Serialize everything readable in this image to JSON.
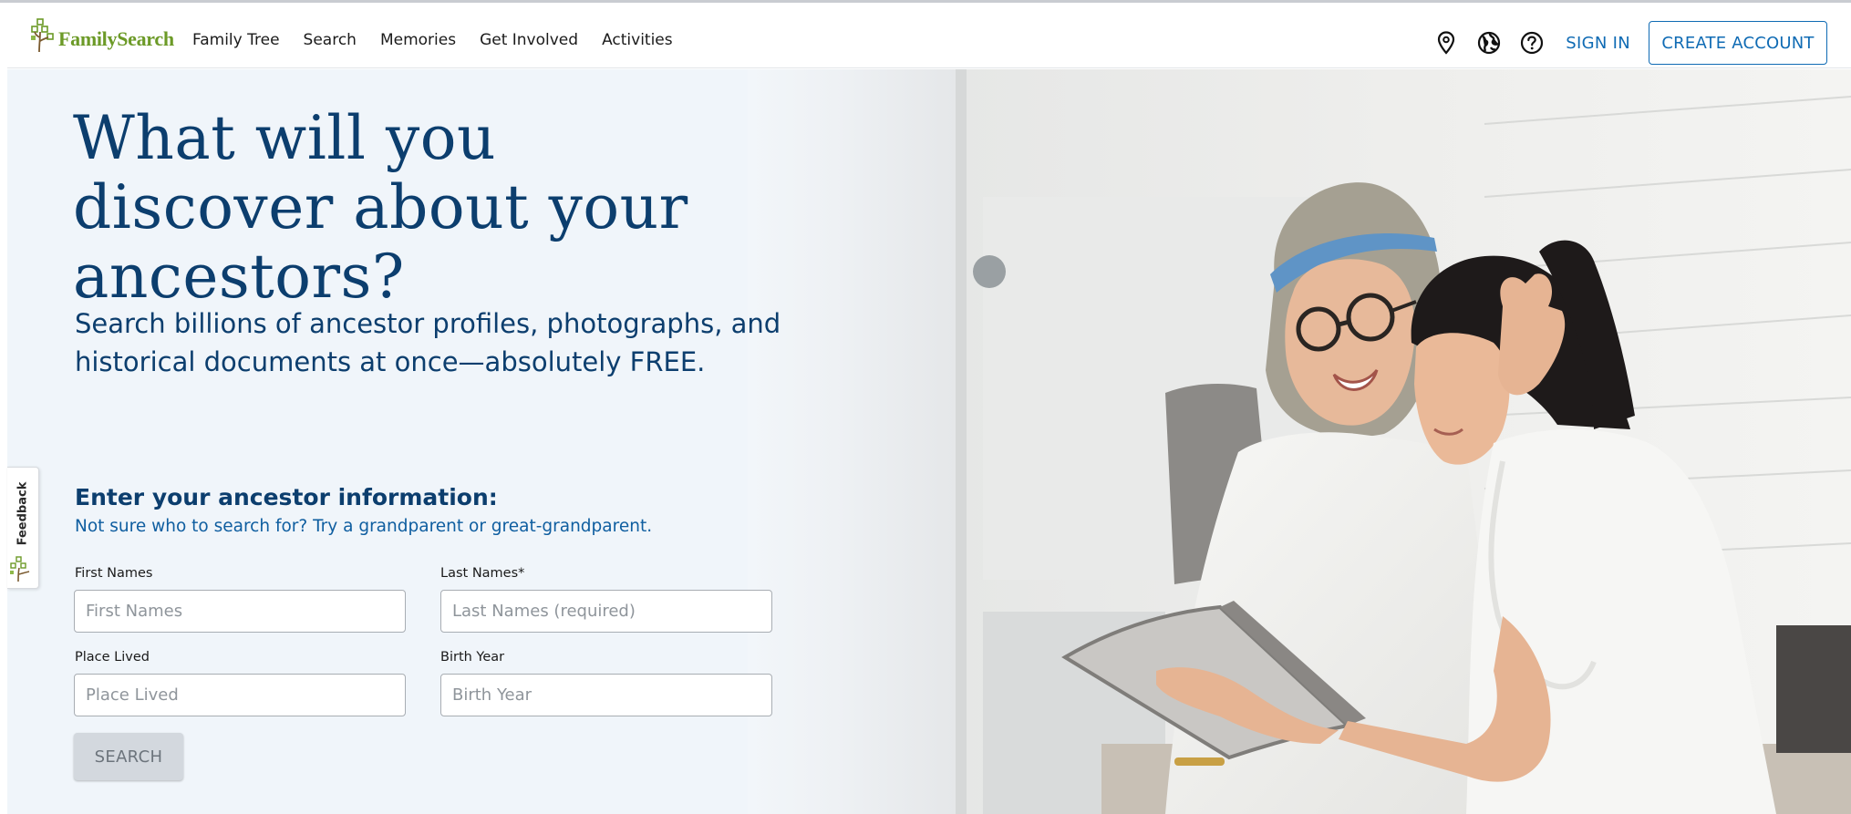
{
  "header": {
    "logo_text": "FamilySearch",
    "nav": [
      "Family Tree",
      "Search",
      "Memories",
      "Get Involved",
      "Activities"
    ],
    "icons": [
      "location-pin-icon",
      "globe-icon",
      "help-icon"
    ],
    "sign_in": "SIGN IN",
    "create_account": "CREATE ACCOUNT"
  },
  "hero": {
    "headline": "What will you discover about your ancestors?",
    "subhead": "Search billions of ancestor profiles, photographs, and historical documents at once—absolutely FREE."
  },
  "form": {
    "title": "Enter your ancestor information:",
    "hint": "Not sure who to search for? Try a grandparent or great-grandparent.",
    "first_names": {
      "label": "First Names",
      "placeholder": "First Names"
    },
    "last_names": {
      "label": "Last Names*",
      "placeholder": "Last Names (required)"
    },
    "place_lived": {
      "label": "Place Lived",
      "placeholder": "Place Lived"
    },
    "birth_year": {
      "label": "Birth Year",
      "placeholder": "Birth Year"
    },
    "search_button": "SEARCH"
  },
  "feedback": {
    "label": "Feedback"
  },
  "colors": {
    "brand_green": "#6c9a27",
    "link_blue": "#0f6bb4",
    "heading_navy": "#0c3e6e",
    "hero_bg": "#f0f5fa"
  }
}
